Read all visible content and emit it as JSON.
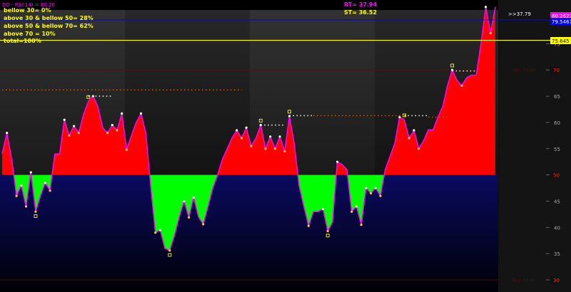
{
  "header": {
    "indicator": "DD - RSI(14) = 80.26",
    "rt": "RT= 37.94",
    "st": "ST= 36.52"
  },
  "stats": [
    "bellow 30= 0%",
    "above 30 & bellow 50= 28%",
    "above 50 & bellow 70= 62%",
    "above 70 = 10%",
    "total=100%"
  ],
  "colors": {
    "up_fill": "#ff0000",
    "down_fill": "#00ff00",
    "rsi_line": "#ff00ff",
    "line_blue": "#0000ff",
    "line_yellow": "#ffff00",
    "stat_text": "#ffff00",
    "header_text": "#ff00ff",
    "level_label_bg": "#cc0000",
    "value_tag": "#ff00ff"
  },
  "chart_data": {
    "type": "area",
    "indicator": "RSI(14)",
    "ylim": [
      30,
      82
    ],
    "baseline": 50,
    "y_ticks": [
      30,
      35,
      40,
      45,
      50,
      55,
      60,
      65,
      70,
      75
    ],
    "highlighted_levels": [
      30,
      50,
      70
    ],
    "faint_labels": [
      {
        "text": "Sell: 70.00",
        "level": 70
      },
      {
        "text": "Buy: 30.00",
        "level": 30
      }
    ],
    "price_tags": [
      {
        "text": "80.2623",
        "value": 80.26,
        "color": "#ff00ff"
      },
      {
        "text": "79.5467",
        "value": 79.55,
        "color": "#0000ff"
      },
      {
        "text": "75.645",
        "value": 75.645,
        "color": "#ffff00"
      }
    ],
    "horizontal_lines": [
      {
        "value": 79.55,
        "color": "#0000ff",
        "label": ">>37.79"
      },
      {
        "value": 75.645,
        "color": "#ffff00"
      }
    ],
    "values": [
      54,
      58,
      53,
      46,
      48,
      44,
      50.5,
      43,
      46,
      48.5,
      47,
      54,
      54,
      60.5,
      57.5,
      59.3,
      58,
      61.5,
      64,
      65,
      63,
      59,
      58,
      59.5,
      58.5,
      61.7,
      54.8,
      57.5,
      60,
      61.7,
      58,
      48,
      39,
      39.5,
      36,
      35.6,
      38.5,
      42,
      45,
      41.9,
      45.7,
      42,
      40.6,
      44,
      47.5,
      50,
      53,
      55,
      57,
      58.5,
      57,
      59,
      55.5,
      57,
      59.5,
      55,
      57.3,
      55,
      57.3,
      54.5,
      61.2,
      56,
      48,
      44,
      40.3,
      43,
      43,
      43.5,
      39.3,
      41,
      52.5,
      52,
      51,
      43,
      44,
      40.5,
      47.5,
      46.5,
      47.5,
      46,
      51,
      53.5,
      56,
      61,
      60.5,
      57,
      58.5,
      55,
      56.5,
      58.6,
      58.6,
      61,
      63,
      67,
      70,
      68,
      67,
      68.5,
      69,
      69,
      75,
      82,
      77,
      82
    ]
  }
}
